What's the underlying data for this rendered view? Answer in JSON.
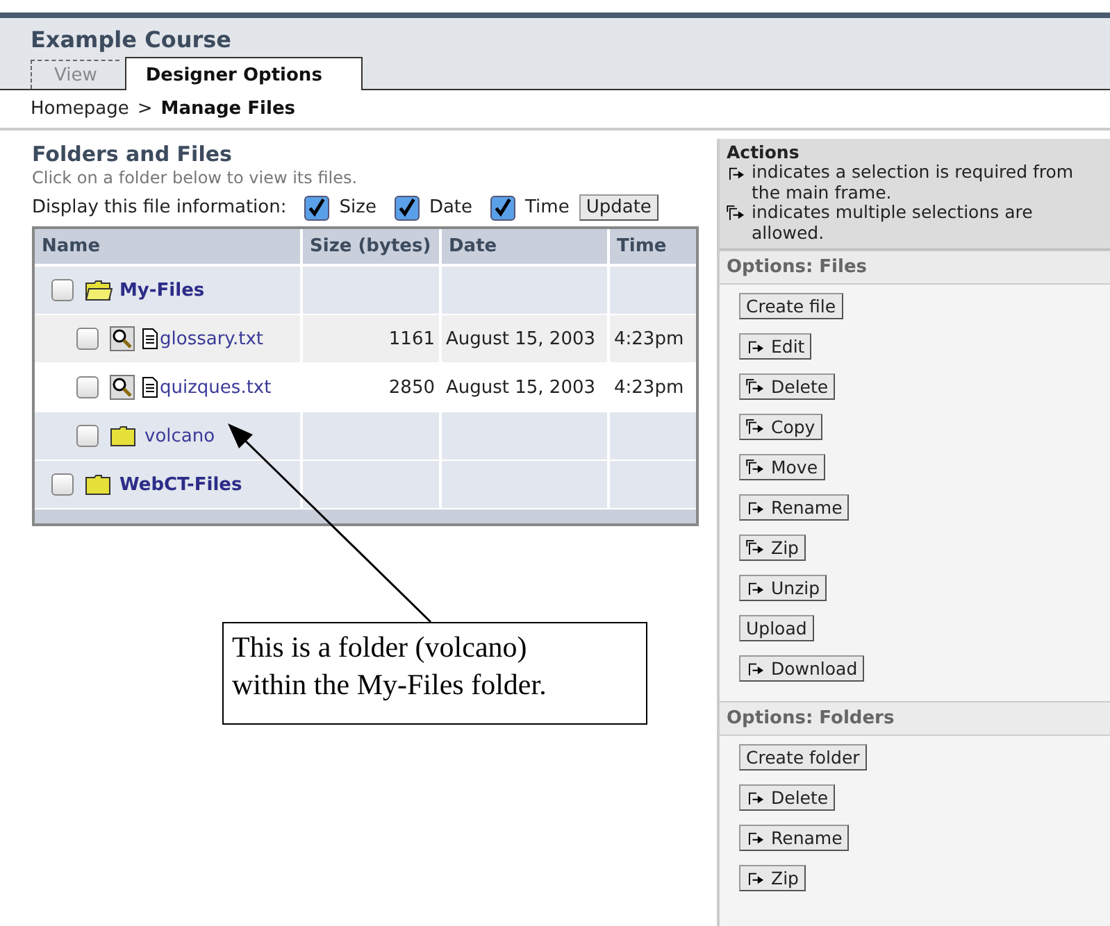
{
  "course_title": "Example Course",
  "tabs": [
    {
      "label": "View",
      "selected": false
    },
    {
      "label": "Designer Options",
      "selected": true
    }
  ],
  "breadcrumb": {
    "link": "Homepage",
    "separator": ">",
    "current": "Manage Files"
  },
  "panel": {
    "title": "Folders and Files",
    "hint": "Click on a folder below to view its files.",
    "display_label": "Display this file information:",
    "display_options": [
      {
        "label": "Size",
        "checked": true
      },
      {
        "label": "Date",
        "checked": true
      },
      {
        "label": "Time",
        "checked": true
      }
    ],
    "update_button": "Update"
  },
  "table": {
    "columns": [
      "Name",
      "Size (bytes)",
      "Date",
      "Time"
    ],
    "rows": [
      {
        "kind": "folder",
        "name": "My-Files",
        "expanded": true,
        "checked": false,
        "children": [
          {
            "kind": "file",
            "name": "glossary.txt",
            "size": "1161",
            "date": "August 15, 2003",
            "time": "4:23pm",
            "checked": false
          },
          {
            "kind": "file",
            "name": "quizques.txt",
            "size": "2850",
            "date": "August 15, 2003",
            "time": "4:23pm",
            "checked": false
          },
          {
            "kind": "folder",
            "name": "volcano",
            "expanded": false,
            "checked": false
          }
        ]
      },
      {
        "kind": "folder",
        "name": "WebCT-Files",
        "expanded": false,
        "checked": false
      }
    ]
  },
  "callout": "This is a folder (volcano) within the My-Files folder.",
  "actions": {
    "title": "Actions",
    "notes": [
      {
        "kind": "single",
        "text": "indicates a selection is required from the main frame."
      },
      {
        "kind": "multi",
        "text": "indicates multiple selections are allowed."
      }
    ]
  },
  "sections": [
    {
      "title": "Options: Files",
      "buttons": [
        {
          "kind": "plain",
          "label": "Create file"
        },
        {
          "kind": "single",
          "label": "Edit"
        },
        {
          "kind": "multi",
          "label": "Delete"
        },
        {
          "kind": "multi",
          "label": "Copy"
        },
        {
          "kind": "multi",
          "label": "Move"
        },
        {
          "kind": "single",
          "label": "Rename"
        },
        {
          "kind": "multi",
          "label": "Zip"
        },
        {
          "kind": "single",
          "label": "Unzip"
        },
        {
          "kind": "plain",
          "label": "Upload"
        },
        {
          "kind": "single",
          "label": "Download"
        }
      ]
    },
    {
      "title": "Options: Folders",
      "buttons": [
        {
          "kind": "plain",
          "label": "Create folder"
        },
        {
          "kind": "single",
          "label": "Delete"
        },
        {
          "kind": "single",
          "label": "Rename"
        },
        {
          "kind": "single",
          "label": "Zip"
        }
      ]
    }
  ]
}
